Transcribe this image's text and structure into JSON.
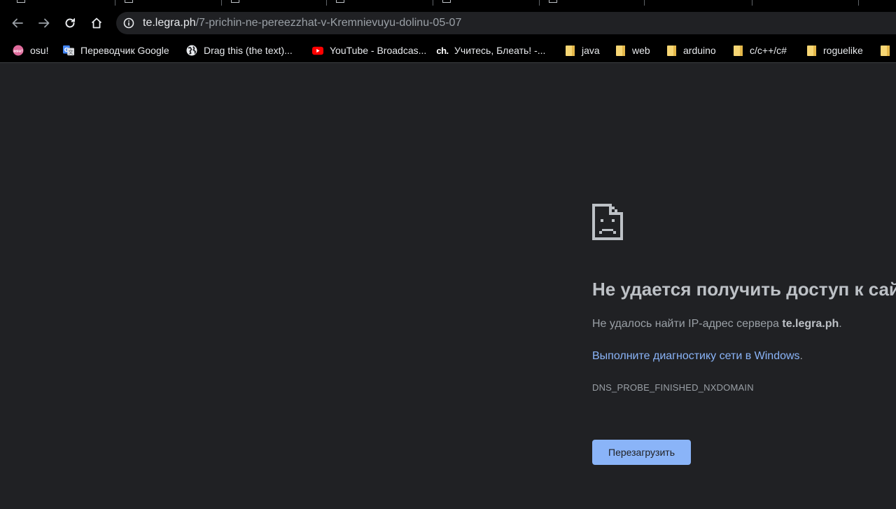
{
  "browser": {
    "address_bar": {
      "host": "te.legra.ph",
      "path": "/7-prichin-ne-pereezzhat-v-Kremnievuyu-dolinu-05-07"
    },
    "nav_icons": [
      "back-icon",
      "forward-icon",
      "reload-icon",
      "home-icon",
      "info-icon"
    ]
  },
  "bookmarks": [
    {
      "label": "osu!",
      "icon": "osu-icon"
    },
    {
      "label": "Переводчик Google",
      "icon": "google-translate-icon"
    },
    {
      "label": "Drag this (the text)...",
      "icon": "globe-icon"
    },
    {
      "label": "YouTube - Broadcas...",
      "icon": "youtube-icon"
    },
    {
      "label": "Учитесь, Блеать! -...",
      "icon_text": "ch.",
      "icon": "ch-icon"
    },
    {
      "label": "java",
      "icon": "folder-icon"
    },
    {
      "label": "web",
      "icon": "folder-icon"
    },
    {
      "label": "arduino",
      "icon": "folder-icon"
    },
    {
      "label": "c/c++/c#",
      "icon": "folder-icon"
    },
    {
      "label": "roguelike",
      "icon": "folder-icon"
    },
    {
      "label": "",
      "icon": "folder-icon"
    }
  ],
  "error_page": {
    "title": "Не удается получить доступ к сайту",
    "description_prefix": "Не удалось найти IP-адрес сервера ",
    "host": "te.legra.ph",
    "description_suffix": ".",
    "diagnostic_link": "Выполните диагностику сети в Windows",
    "diagnostic_suffix": ".",
    "error_code": "DNS_PROBE_FINISHED_NXDOMAIN",
    "reload_button": "Перезагрузить"
  },
  "colors": {
    "page_bg": "#202124",
    "chrome_bg": "#000000",
    "link": "#8ab4f8",
    "button_bg": "#8ab4f8"
  }
}
